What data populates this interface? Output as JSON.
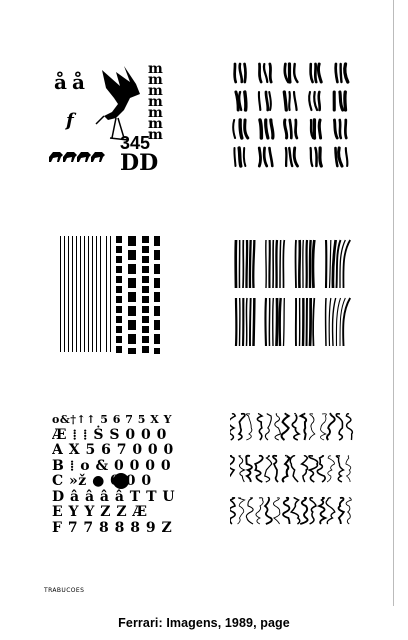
{
  "caption": "Ferrari: Imagens, 1989, page",
  "signature": "TRABUCOES",
  "panels": {
    "top_left": {
      "glyphs": {
        "a_ring_1": "å",
        "a_ring_2": "å",
        "f": "f",
        "digits": "345",
        "dd": "DD",
        "m_column": [
          "m",
          "m",
          "m",
          "m",
          "m",
          "m",
          "m"
        ]
      },
      "icons": [
        "bird-illustration",
        "running-figures"
      ]
    },
    "top_right": {
      "pattern": "gothic-letter-grid"
    },
    "middle_left": {
      "pattern": "vertical-line-barcode"
    },
    "middle_right": {
      "pattern": "vertical-stroke-clusters"
    },
    "bottom_left": {
      "rows": [
        "o&†↑↑ 5 6 7 5 X Y",
        "Æ ⁞ ⁞ Ṡ S 0 0 0",
        "A X 5 6 7 0 0 0",
        "B ⁞ o & 0 0 0 0",
        "C »ž ● 0 0 0",
        "D â â â â T T U",
        "E Y Y Z Z Æ",
        "F 7 7 8 8 8 9 Z Æ"
      ]
    },
    "bottom_right": {
      "pattern": "handwritten-scribble-rows"
    }
  }
}
